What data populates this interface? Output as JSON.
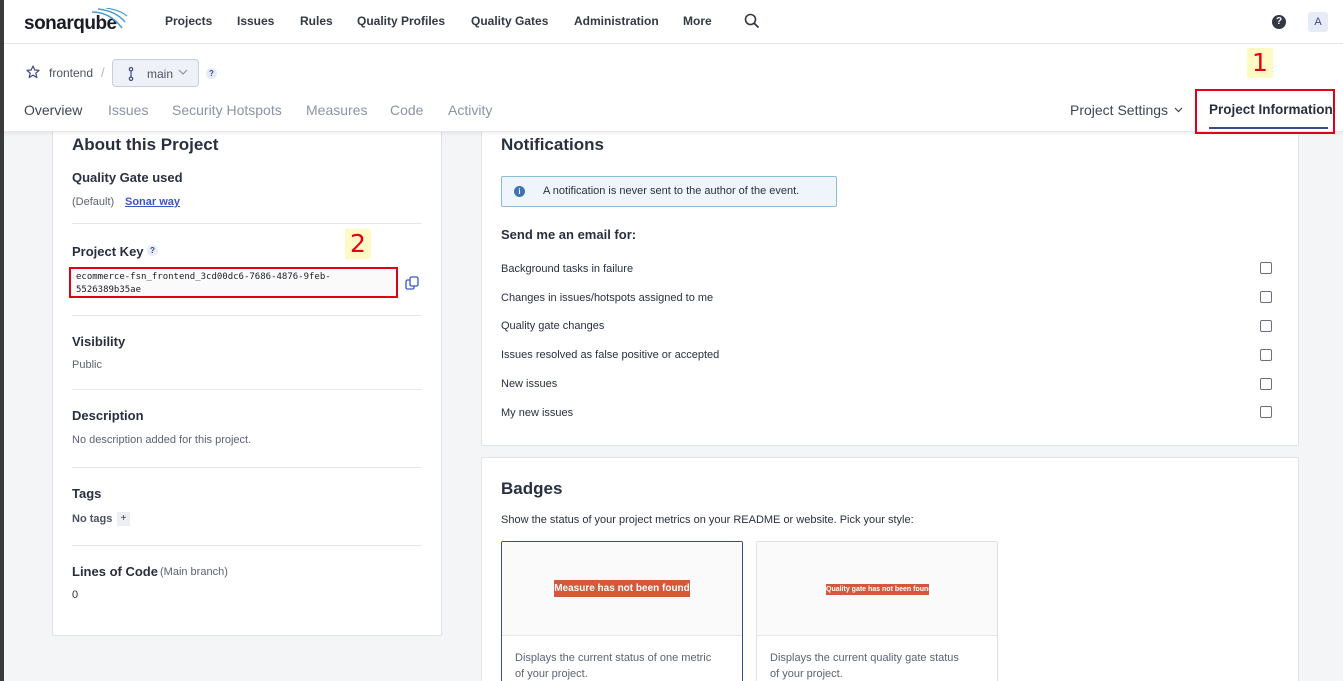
{
  "app": {
    "logo": "sonarqube"
  },
  "topnav": {
    "items": [
      "Projects",
      "Issues",
      "Rules",
      "Quality Profiles",
      "Quality Gates",
      "Administration",
      "More"
    ],
    "help": "?",
    "avatar": "A"
  },
  "breadcrumb": {
    "project": "frontend",
    "separator": "/",
    "branch": "main",
    "branch_help": "?"
  },
  "tabs": [
    "Overview",
    "Issues",
    "Security Hotspots",
    "Measures",
    "Code",
    "Activity"
  ],
  "right_tabs": {
    "settings": "Project Settings",
    "information": "Project Information"
  },
  "annotations": {
    "marker1": "1",
    "marker2": "2"
  },
  "about": {
    "title": "About this Project",
    "quality_gate_label": "Quality Gate used",
    "quality_gate_default": "(Default)",
    "quality_gate_link": "Sonar way",
    "project_key_label": "Project Key",
    "project_key_help": "?",
    "project_key": "ecommerce-fsn_frontend_3cd00dc6-7686-4876-9feb-\n5526389b35ae",
    "visibility_label": "Visibility",
    "visibility": "Public",
    "description_label": "Description",
    "description": "No description added for this project.",
    "tags_label": "Tags",
    "tags": "No tags",
    "tags_add": "+",
    "loc_label": "Lines of Code",
    "loc_scope": "(Main branch)",
    "loc_value": "0"
  },
  "notifications": {
    "title": "Notifications",
    "info": "A notification is never sent to the author of the event.",
    "subtitle": "Send me an email for:",
    "items": [
      "Background tasks in failure",
      "Changes in issues/hotspots assigned to me",
      "Quality gate changes",
      "Issues resolved as false positive or accepted",
      "New issues",
      "My new issues"
    ]
  },
  "badges": {
    "title": "Badges",
    "subtitle": "Show the status of your project metrics on your README or website. Pick your style:",
    "cards": [
      {
        "badge": "Measure has not been found",
        "desc": "Displays the current status of one metric of your project."
      },
      {
        "badge": "Quality gate has not been found",
        "desc": "Displays the current quality gate status of your project."
      }
    ]
  },
  "colors": {
    "accent": "#3d4a8a",
    "link": "#3d55c4",
    "annotation": "#e0001a",
    "badge": "#d5573c",
    "info_border": "#8cbcdc"
  }
}
